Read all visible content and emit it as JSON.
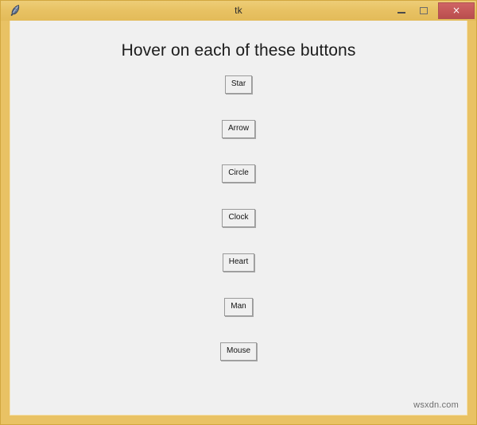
{
  "window": {
    "title": "tk",
    "icon": "feather-icon",
    "frame_color": "#e9c264",
    "client_bg": "#f0f0f0"
  },
  "titlebar": {
    "minimize_label": "–",
    "maximize_label": "□",
    "close_label": "×",
    "close_color": "#c45757"
  },
  "content": {
    "heading": "Hover on each of these buttons",
    "buttons": [
      {
        "label": "Star"
      },
      {
        "label": "Arrow"
      },
      {
        "label": "Circle"
      },
      {
        "label": "Clock"
      },
      {
        "label": "Heart"
      },
      {
        "label": "Man"
      },
      {
        "label": "Mouse"
      }
    ]
  },
  "watermark": {
    "text": "wsxdn.com"
  }
}
